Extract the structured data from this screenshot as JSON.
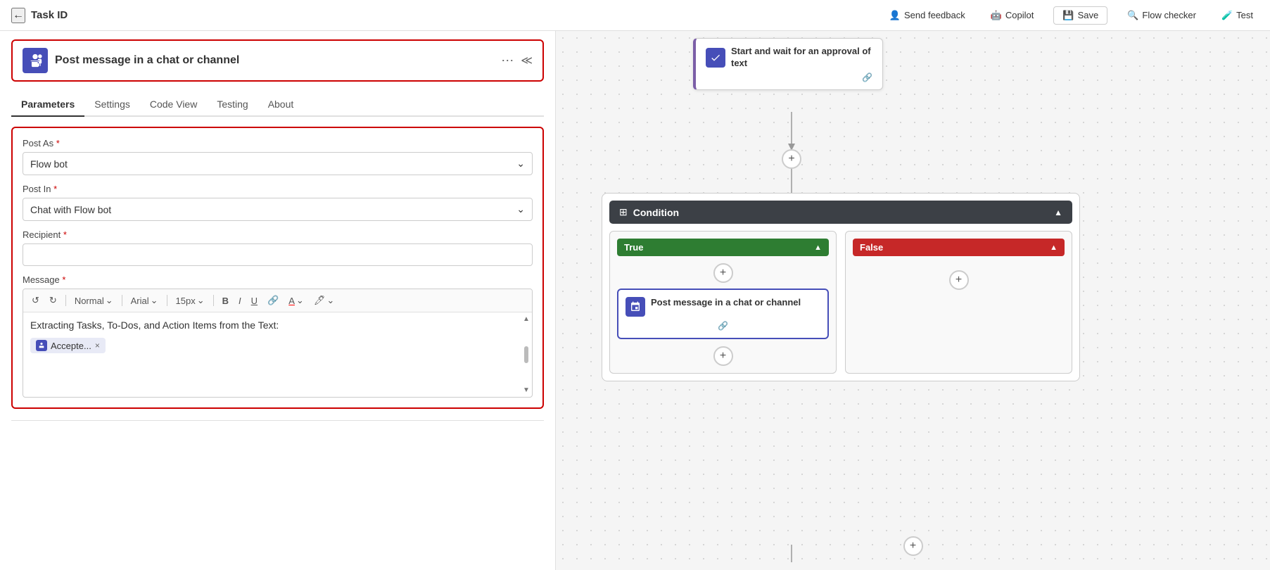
{
  "topBar": {
    "backIcon": "←",
    "taskTitle": "Task ID",
    "sendFeedbackLabel": "Send feedback",
    "copilotLabel": "Copilot",
    "saveLabel": "Save",
    "flowCheckerLabel": "Flow checker",
    "testLabel": "Test"
  },
  "actionHeader": {
    "title": "Post message in a chat or channel",
    "iconLabel": "teams-icon",
    "dotsLabel": "⋯",
    "collapseLabel": "≪"
  },
  "tabs": [
    {
      "id": "parameters",
      "label": "Parameters",
      "active": true
    },
    {
      "id": "settings",
      "label": "Settings",
      "active": false
    },
    {
      "id": "codeview",
      "label": "Code View",
      "active": false
    },
    {
      "id": "testing",
      "label": "Testing",
      "active": false
    },
    {
      "id": "about",
      "label": "About",
      "active": false
    }
  ],
  "parameters": {
    "postAsLabel": "Post As",
    "postAsRequired": "*",
    "postAsValue": "Flow bot",
    "postInLabel": "Post In",
    "postInRequired": "*",
    "postInValue": "Chat with Flow bot",
    "recipientLabel": "Recipient",
    "recipientRequired": "*",
    "recipientPlaceholder": "",
    "messageLabel": "Message",
    "messageRequired": "*",
    "messageText": "Extracting Tasks, To-Dos, and Action Items from the Text:",
    "tagChipText": "Accepte...",
    "toolbarNormal": "Normal",
    "toolbarFont": "Arial",
    "toolbarSize": "15px"
  },
  "flow": {
    "approvalNode": {
      "title": "Start and wait for an approval of text",
      "iconLabel": "approval-icon"
    },
    "conditionNode": {
      "title": "Condition",
      "iconLabel": "condition-icon"
    },
    "trueBranch": {
      "label": "True",
      "postMsgTitle": "Post message in a chat or channel"
    },
    "falseBranch": {
      "label": "False"
    }
  }
}
